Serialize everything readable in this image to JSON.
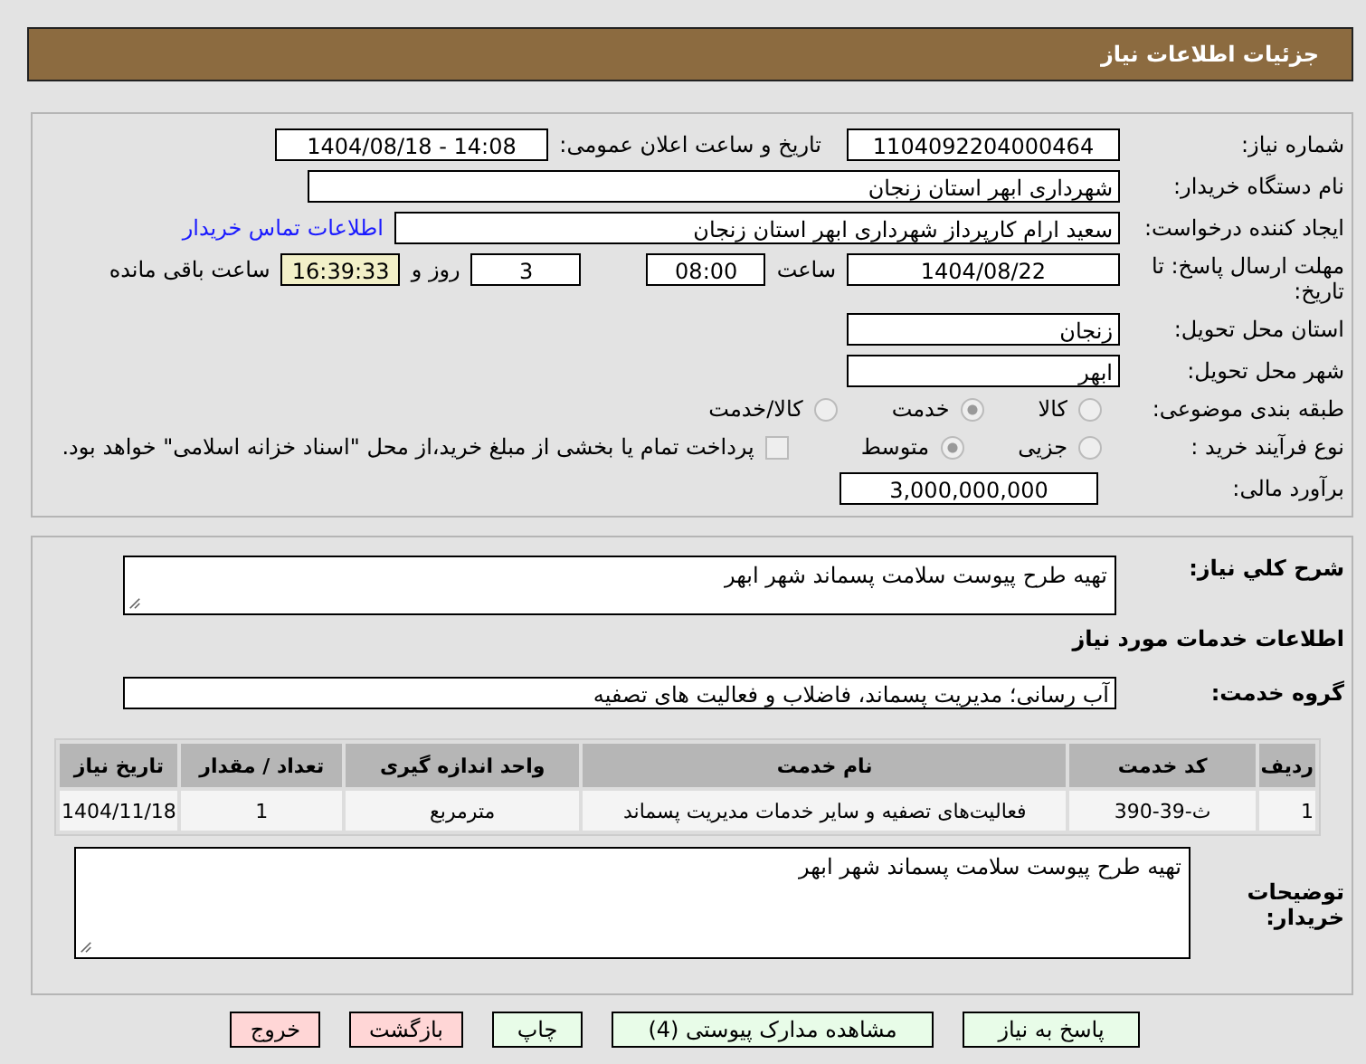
{
  "header_title": "جزئیات اطلاعات نیاز",
  "need_number": {
    "label": "شماره نیاز:",
    "value": "1104092204000464"
  },
  "announce": {
    "label": "تاریخ و ساعت اعلان عمومی:",
    "value": "1404/08/18 - 14:08"
  },
  "buyer": {
    "label": "نام دستگاه خریدار:",
    "value": "شهرداری ابهر استان زنجان"
  },
  "creator": {
    "label": "ایجاد کننده درخواست:",
    "value": "سعید ارام کارپرداز  شهرداری ابهر استان زنجان",
    "link": "اطلاعات تماس خریدار"
  },
  "deadline": {
    "label": "مهلت ارسال پاسخ: تا تاریخ:",
    "date": "1404/08/22",
    "time_label": "ساعت",
    "time": "08:00",
    "days": "3",
    "days_label": "روز و",
    "remaining": "16:39:33",
    "remaining_label": "ساعت باقی مانده"
  },
  "province": {
    "label": "استان محل تحویل:",
    "value": "زنجان"
  },
  "city": {
    "label": "شهر محل تحویل:",
    "value": "ابهر"
  },
  "category": {
    "label": "طبقه بندی موضوعی:",
    "options": [
      {
        "label": "کالا",
        "selected": false
      },
      {
        "label": "خدمت",
        "selected": true
      },
      {
        "label": "کالا/خدمت",
        "selected": false
      }
    ]
  },
  "process": {
    "label": "نوع فرآیند خرید :",
    "options": [
      {
        "label": "جزیی",
        "selected": false
      },
      {
        "label": "متوسط",
        "selected": true
      }
    ],
    "payment": {
      "checked": false,
      "text": "پرداخت تمام یا بخشی از مبلغ خرید،از محل \"اسناد خزانه اسلامی\" خواهد بود."
    }
  },
  "budget": {
    "label": "برآورد مالی:",
    "value": "3,000,000,000"
  },
  "description": {
    "label": "شرح کلي نیاز:",
    "value": "تهیه طرح پیوست سلامت پسماند شهر ابهر"
  },
  "services_title": "اطلاعات خدمات مورد نیاز",
  "service_group": {
    "label": "گروه خدمت:",
    "value": "آب رسانی؛ مدیریت پسماند، فاضلاب و فعالیت های تصفیه"
  },
  "table": {
    "columns": [
      "ردیف",
      "کد خدمت",
      "نام خدمت",
      "واحد اندازه گیری",
      "تعداد / مقدار",
      "تاریخ نیاز"
    ],
    "rows": [
      [
        "1",
        "ث-39-390",
        "فعالیت‌های تصفیه و سایر خدمات مدیریت پسماند",
        "مترمربع",
        "1",
        "1404/11/18"
      ]
    ]
  },
  "buyer_notes": {
    "label": "توضیحات خریدار:",
    "value": "تهیه طرح پیوست سلامت پسماند شهر ابهر"
  },
  "buttons": [
    {
      "label": "پاسخ به نیاز",
      "kind": "green"
    },
    {
      "label": "مشاهده مدارک پیوستی (4)",
      "kind": "green"
    },
    {
      "label": "چاپ",
      "kind": "green"
    },
    {
      "label": "بازگشت",
      "kind": "red"
    },
    {
      "label": "خروج",
      "kind": "red"
    }
  ]
}
